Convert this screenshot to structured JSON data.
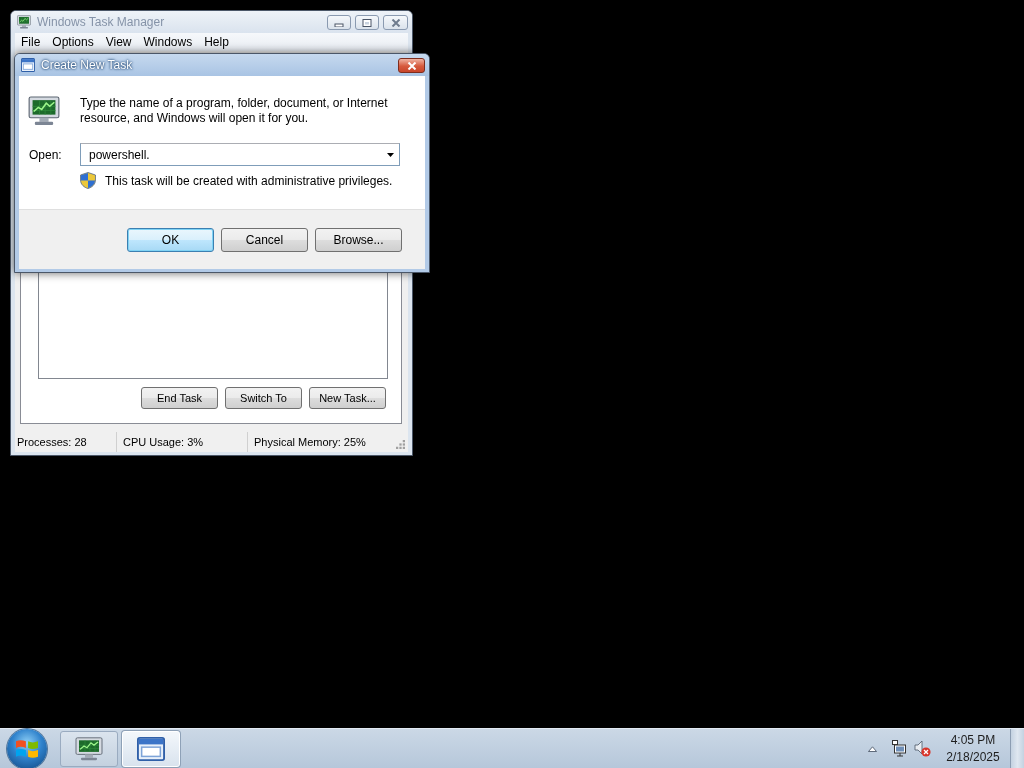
{
  "task_manager": {
    "title": "Windows Task Manager",
    "active": false,
    "menu": [
      "File",
      "Options",
      "View",
      "Windows",
      "Help"
    ],
    "buttons": [
      "End Task",
      "Switch To",
      "New Task..."
    ],
    "status_bar": [
      "Processes: 28",
      "CPU Usage: 3%",
      "Physical Memory: 25%"
    ]
  },
  "dialog": {
    "title": "Create New Task",
    "active": true,
    "message": "Type the name of a program, folder, document, or Internet resource, and Windows will open it for you.",
    "open_label": "Open:",
    "open_field": {
      "value": "powershell."
    },
    "note": "This task will be created with administrative privileges.",
    "buttons": [
      {
        "label": "OK",
        "default": true
      },
      {
        "label": "Cancel",
        "default": false
      },
      {
        "label": "Browse...",
        "default": false
      }
    ]
  },
  "taskbar": {
    "buttons": [
      {
        "kind": "monitor",
        "selected": false
      },
      {
        "kind": "window",
        "selected": true
      }
    ],
    "tray": {
      "volume_muted": true
    },
    "clock": {
      "time": "4:05 PM",
      "date": "2/18/2025"
    }
  }
}
